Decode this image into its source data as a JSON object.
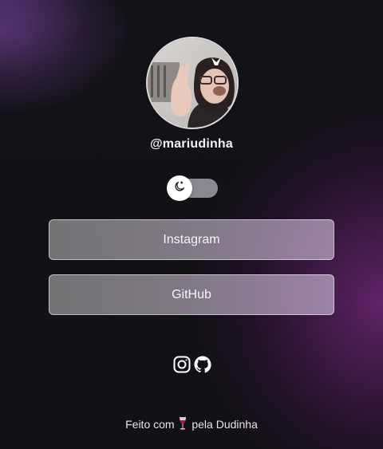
{
  "profile": {
    "username": "@mariudinha",
    "avatar_icon": "profile-photo"
  },
  "theme_toggle": {
    "icon": "moon-icon",
    "state": "dark"
  },
  "links": [
    {
      "label": "Instagram"
    },
    {
      "label": "GitHub"
    }
  ],
  "social_icons": [
    "instagram-icon",
    "github-icon"
  ],
  "footer": {
    "prefix": "Feito com",
    "icon": "wine-glass-icon",
    "suffix": "pela Dudinha"
  },
  "colors": {
    "background": "#131217",
    "accent_purple": "#7a2f82",
    "button_fill": "#b3aeb8",
    "toggle_track": "#8a8890"
  }
}
